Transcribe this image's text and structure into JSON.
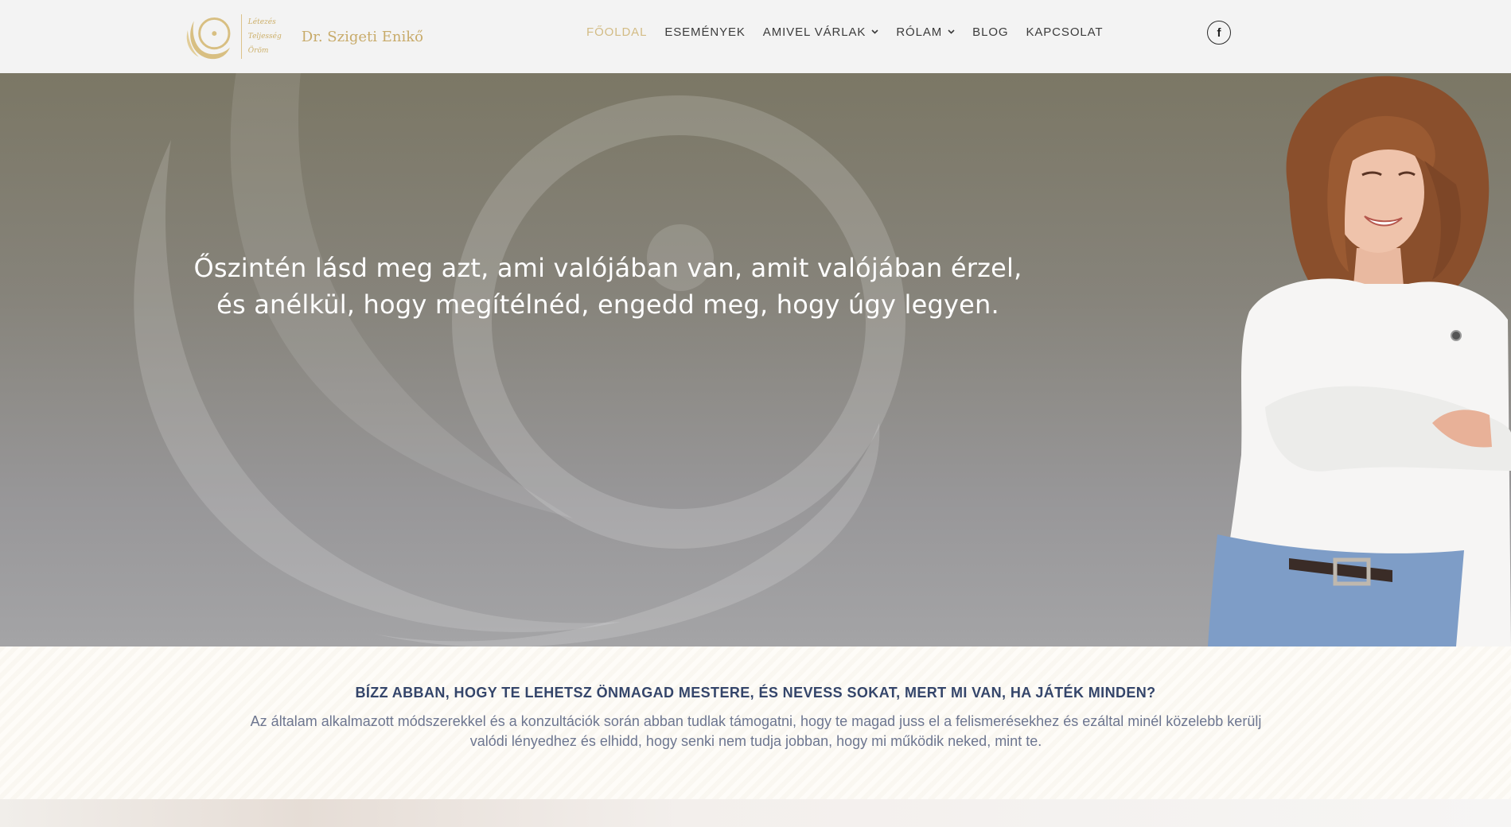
{
  "brand": {
    "name": "Dr. Szigeti Enikő",
    "tagline": [
      "Létezés",
      "Teljesség",
      "Öröm"
    ],
    "accent_color": "#d3bc85"
  },
  "nav": {
    "items": [
      {
        "label": "FŐOLDAL",
        "active": true,
        "dropdown": false
      },
      {
        "label": "ESEMÉNYEK",
        "active": false,
        "dropdown": false
      },
      {
        "label": "AMIVEL VÁRLAK",
        "active": false,
        "dropdown": true
      },
      {
        "label": "RÓLAM",
        "active": false,
        "dropdown": true
      },
      {
        "label": "BLOG",
        "active": false,
        "dropdown": false
      },
      {
        "label": "KAPCSOLAT",
        "active": false,
        "dropdown": false
      }
    ],
    "social_icon": "facebook-icon",
    "social_glyph": "f"
  },
  "hero": {
    "quote": "Őszintén lásd meg azt, ami valójában van, amit valójában érzel, és anélkül, hogy megítélnéd, engedd meg, hogy úgy legyen."
  },
  "intro": {
    "title": "BÍZZ ABBAN, HOGY TE LEHETSZ ÖNMAGAD MESTERE, ÉS NEVESS SOKAT, MERT MI VAN, HA JÁTÉK MINDEN?",
    "text": "Az általam alkalmazott módszerekkel és a konzultációk során abban tudlak támogatni, hogy te magad juss el a felismerésekhez és ezáltal minél közelebb kerülj valódi lényedhez és elhidd, hogy senki nem tudja jobban, hogy mi működik neked, mint te.",
    "title_color": "#34456a",
    "text_color": "#6d7690"
  }
}
